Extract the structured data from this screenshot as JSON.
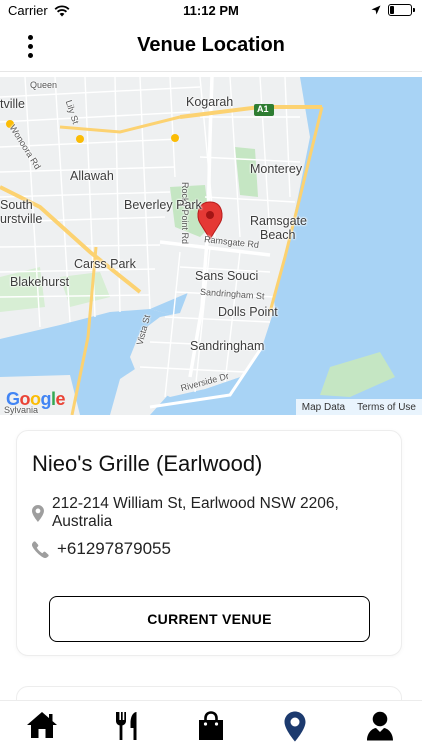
{
  "status_bar": {
    "carrier": "Carrier",
    "time": "11:12 PM",
    "battery_level": 0.2
  },
  "header": {
    "title": "Venue Location",
    "menu_icon": "more-vertical-icon"
  },
  "map": {
    "labels": {
      "kogarah": "Kogarah",
      "a1": "A1",
      "allawah": "Allawah",
      "monterey": "Monterey",
      "beverley_park": "Beverley Park",
      "ramsgate": "Ramsgate",
      "beach": "Beach",
      "south": "South",
      "urstville": "urstville",
      "carss_park": "Carss Park",
      "blakehurst": "Blakehurst",
      "sans_souci": "Sans Souci",
      "dolls_point": "Dolls Point",
      "sandringham": "Sandringham",
      "rocky_point_rd": "Rocky Point Rd",
      "ramsgate_rd": "Ramsgate Rd",
      "sandringham_st": "Sandringham St",
      "vista_st": "Vista St",
      "riverside_dr": "Riverside Dr",
      "wonoora_rd": "Wonoora Rd",
      "lily_st": "Lily St",
      "queen": "Queen",
      "ville": "tville",
      "sylvania": "Sylvania"
    },
    "logo": "Google",
    "attribution": {
      "map_data": "Map Data",
      "terms": "Terms of Use"
    },
    "colors": {
      "water": "#a8d3f5",
      "land": "#eef0f1",
      "park": "#c5e6c3",
      "highway": "#fcd271",
      "marker": "#e53935"
    }
  },
  "venue": {
    "name": "Nieo's Grille (Earlwood)",
    "address": "212-214 William St, Earlwood NSW 2206, Australia",
    "phone": "+61297879055",
    "button_label": "CURRENT VENUE"
  },
  "tabs": [
    {
      "icon": "home-icon",
      "active": false
    },
    {
      "icon": "utensils-icon",
      "active": false
    },
    {
      "icon": "shopping-bag-icon",
      "active": false
    },
    {
      "icon": "map-marker-icon",
      "active": true
    },
    {
      "icon": "user-icon",
      "active": false
    }
  ],
  "colors": {
    "active_tab": "#1c3a6e",
    "inactive_tab": "#000000",
    "muted_icon": "#9e9e9e"
  }
}
